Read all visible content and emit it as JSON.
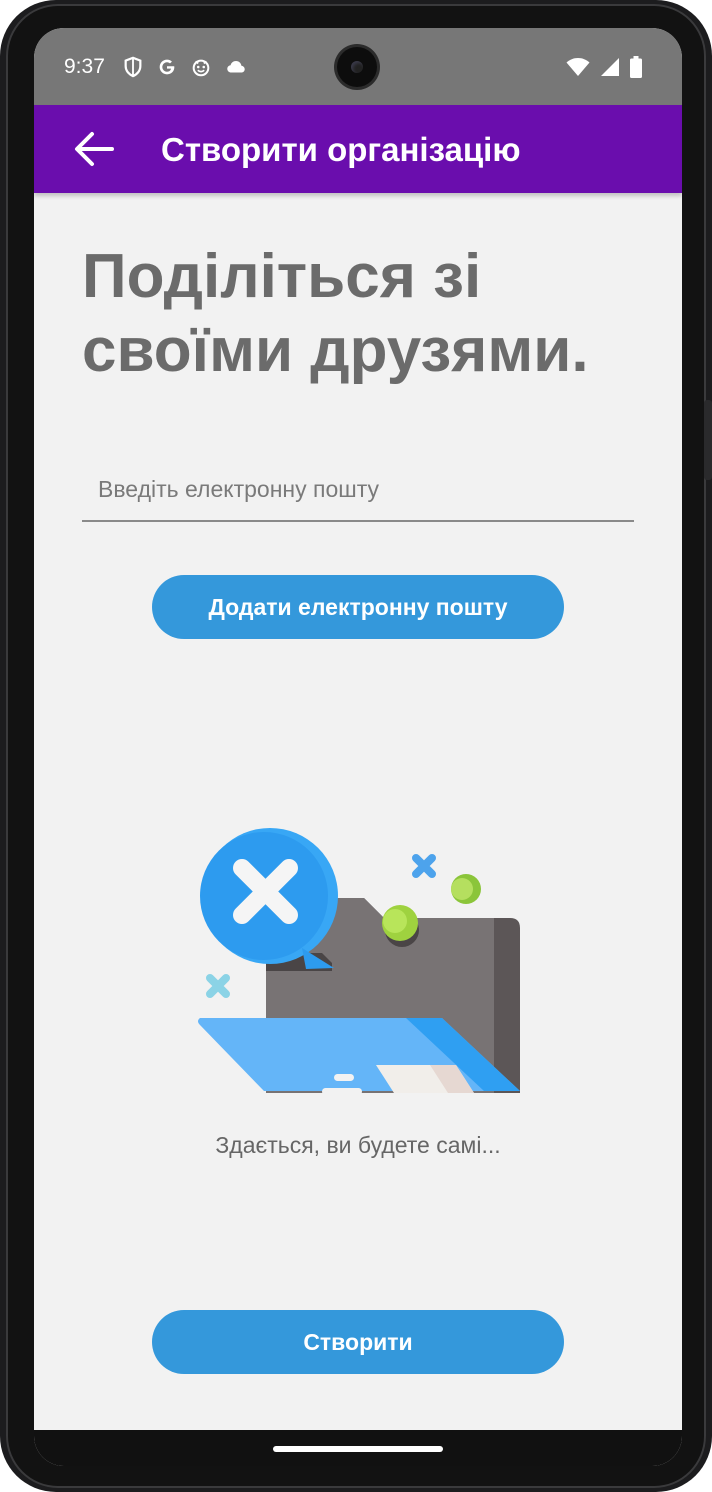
{
  "status_bar": {
    "time": "9:37",
    "left_icons": [
      "shield-icon",
      "google-icon",
      "smiley-icon",
      "cloud-icon"
    ],
    "right_icons": [
      "wifi-icon",
      "signal-icon",
      "battery-icon"
    ]
  },
  "app_bar": {
    "title": "Створити організацію",
    "back_icon": "arrow-back-icon",
    "color": "#6a0dad"
  },
  "main": {
    "headline": "Поділіться зі своїми друзями.",
    "email_input": {
      "placeholder": "Введіть електронну пошту",
      "value": ""
    },
    "add_email_button": "Додати електронну пошту",
    "empty_state_text": "Здається, ви будете самі...",
    "create_button": "Створити",
    "button_color": "#3498db"
  }
}
